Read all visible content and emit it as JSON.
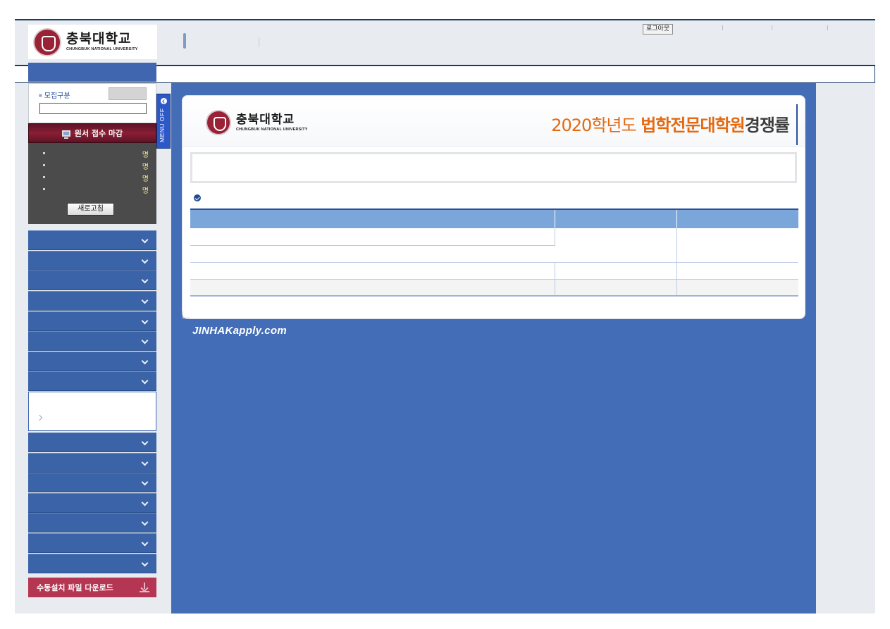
{
  "header": {
    "logo_ko": "충북대학교",
    "logo_en": "CHUNGBUK NATIONAL UNIVERSITY",
    "logout_label": "로그아웃"
  },
  "sidebar": {
    "recruit_label": "모집구분",
    "deadline_label": "원서 접수 마감",
    "stats_unit": [
      "명",
      "명",
      "명",
      "명"
    ],
    "refresh_label": "새로고침",
    "download_label": "수동설치 파일 다운로드",
    "menu_toggle_label": "MENU OFF"
  },
  "panel": {
    "logo_ko": "충북대학교",
    "logo_en": "CHUNGBUK NATIONAL UNIVERSITY",
    "title_year": "2020학년도 ",
    "title_name": "법학전문대학원",
    "title_rate": "경쟁률"
  },
  "footer": {
    "brand": "JINHAKapply.com"
  },
  "colors": {
    "main_bg": "#436db6",
    "menu_item": "#3a63a8",
    "deadline_bar": "#8a1e35",
    "download_btn": "#b53652",
    "title_accent": "#e36a12"
  }
}
